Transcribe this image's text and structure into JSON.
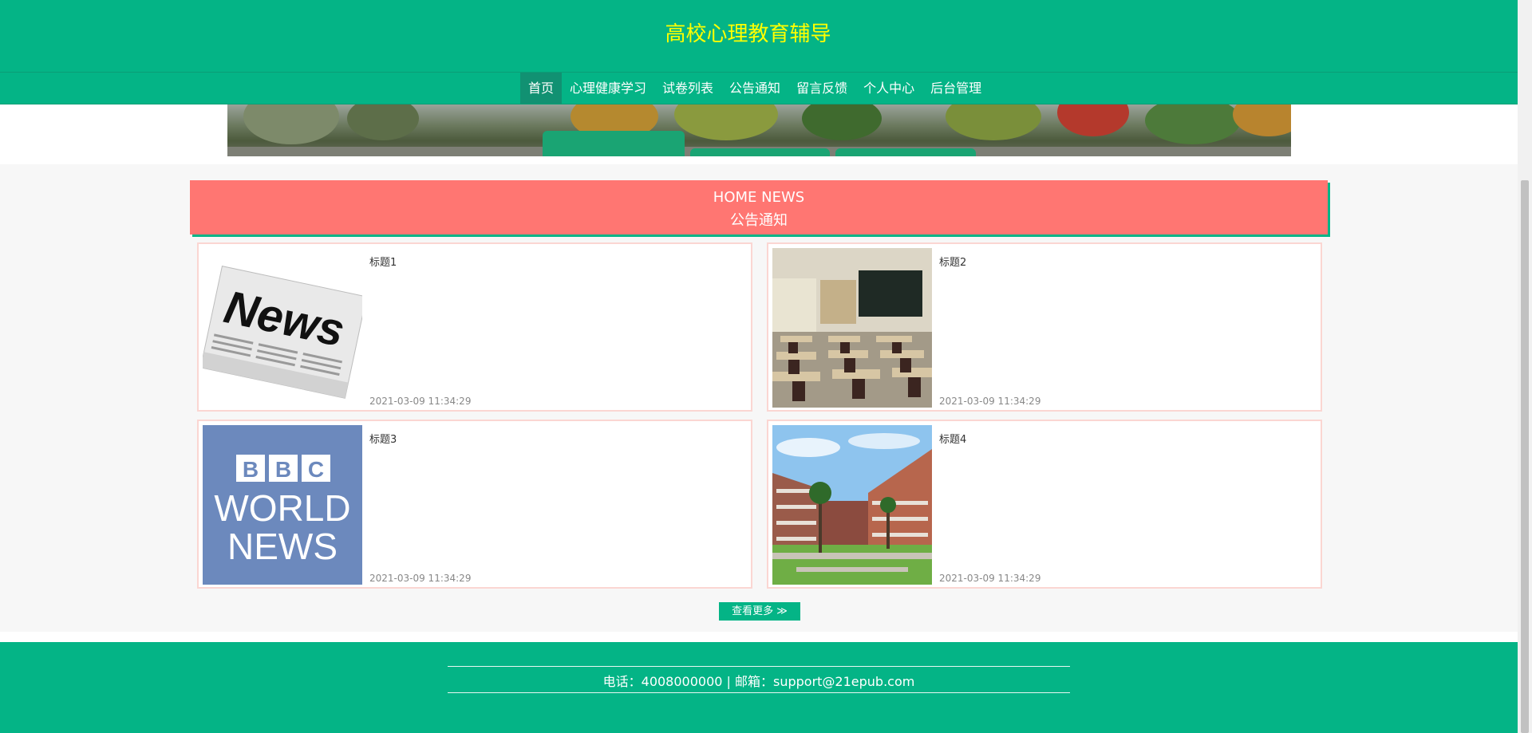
{
  "site": {
    "title": "高校心理教育辅导"
  },
  "nav": {
    "items": [
      {
        "label": "首页"
      },
      {
        "label": "心理健康学习"
      },
      {
        "label": "试卷列表"
      },
      {
        "label": "公告通知"
      },
      {
        "label": "留言反馈"
      },
      {
        "label": "个人中心"
      },
      {
        "label": "后台管理"
      }
    ],
    "active": "首页"
  },
  "news": {
    "heading_en": "HOME NEWS",
    "heading_zh": "公告通知",
    "items": [
      {
        "title": "标题1",
        "time": "2021-03-09 11:34:29",
        "image": "newspaper-image"
      },
      {
        "title": "标题2",
        "time": "2021-03-09 11:34:29",
        "image": "classroom-image"
      },
      {
        "title": "标题3",
        "time": "2021-03-09 11:34:29",
        "image": "bbc-world-news-image"
      },
      {
        "title": "标题4",
        "time": "2021-03-09 11:34:29",
        "image": "campus-building-image"
      }
    ],
    "more_label": "查看更多 ≫"
  },
  "footer": {
    "contact": "电话：4008000000 | 邮箱：support@21epub.com"
  },
  "images": {
    "newspaper_text": "News",
    "bbc_letters": [
      "B",
      "B",
      "C"
    ],
    "bbc_line1": "WORLD",
    "bbc_line2": "NEWS"
  },
  "colors": {
    "primary": "#04b486",
    "title": "#ffff00",
    "news_header": "#ff7672",
    "card_border": "#fbd6d2"
  }
}
